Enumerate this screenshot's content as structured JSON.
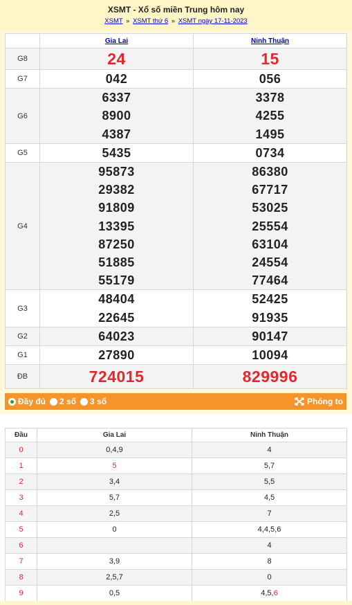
{
  "header": {
    "title": "XSMT - Xổ số miền Trung hôm nay",
    "crumbs": [
      "XSMT",
      "XSMT thứ 6",
      "XSMT ngày 17-11-2023"
    ],
    "sep": "»"
  },
  "provinces": [
    "Gia Lai",
    "Ninh Thuận"
  ],
  "prizes": [
    {
      "label": "G8",
      "style": "big-red",
      "a": [
        "24"
      ],
      "b": [
        "15"
      ]
    },
    {
      "label": "G7",
      "style": "normal",
      "a": [
        "042"
      ],
      "b": [
        "056"
      ]
    },
    {
      "label": "G6",
      "style": "normal",
      "a": [
        "6337",
        "8900",
        "4387"
      ],
      "b": [
        "3378",
        "4255",
        "1495"
      ]
    },
    {
      "label": "G5",
      "style": "normal",
      "a": [
        "5435"
      ],
      "b": [
        "0734"
      ]
    },
    {
      "label": "G4",
      "style": "normal",
      "a": [
        "95873",
        "29382",
        "91809",
        "13395",
        "87250",
        "51885",
        "55179"
      ],
      "b": [
        "86380",
        "67717",
        "53025",
        "25554",
        "63104",
        "24554",
        "77464"
      ]
    },
    {
      "label": "G3",
      "style": "normal",
      "a": [
        "48404",
        "22645"
      ],
      "b": [
        "52425",
        "91935"
      ]
    },
    {
      "label": "G2",
      "style": "normal",
      "a": [
        "64023"
      ],
      "b": [
        "90147"
      ]
    },
    {
      "label": "G1",
      "style": "normal",
      "a": [
        "27890"
      ],
      "b": [
        "10094"
      ]
    },
    {
      "label": "ĐB",
      "style": "db",
      "a": [
        "724015"
      ],
      "b": [
        "829996"
      ]
    }
  ],
  "options": {
    "full": "Đầy đủ",
    "two": "2 số",
    "three": "3 số",
    "zoom": "Phóng to"
  },
  "loto": {
    "head_label": "Đầu",
    "columns": [
      "Gia Lai",
      "Ninh Thuận"
    ],
    "rows": [
      {
        "d": "0",
        "a": "0,4,9",
        "b": "4"
      },
      {
        "d": "1",
        "a": "5",
        "a_red": true,
        "b": "5,7"
      },
      {
        "d": "2",
        "a": "3,4",
        "b": "5,5"
      },
      {
        "d": "3",
        "a": "5,7",
        "b": "4,5"
      },
      {
        "d": "4",
        "a": "2,5",
        "b": "7"
      },
      {
        "d": "5",
        "a": "0",
        "b": "4,4,5,6"
      },
      {
        "d": "6",
        "a": "",
        "b": "4"
      },
      {
        "d": "7",
        "a": "3,9",
        "b": "8"
      },
      {
        "d": "8",
        "a": "2,5,7",
        "b": "0"
      },
      {
        "d": "9",
        "a": "0,5",
        "b": "4,5,",
        "b_red_tail": "6"
      }
    ]
  },
  "colors": {
    "red": "#e2282d",
    "orange_bar": "#f4942b",
    "link": "#0000cc",
    "header_bg": "#fff6c8"
  }
}
